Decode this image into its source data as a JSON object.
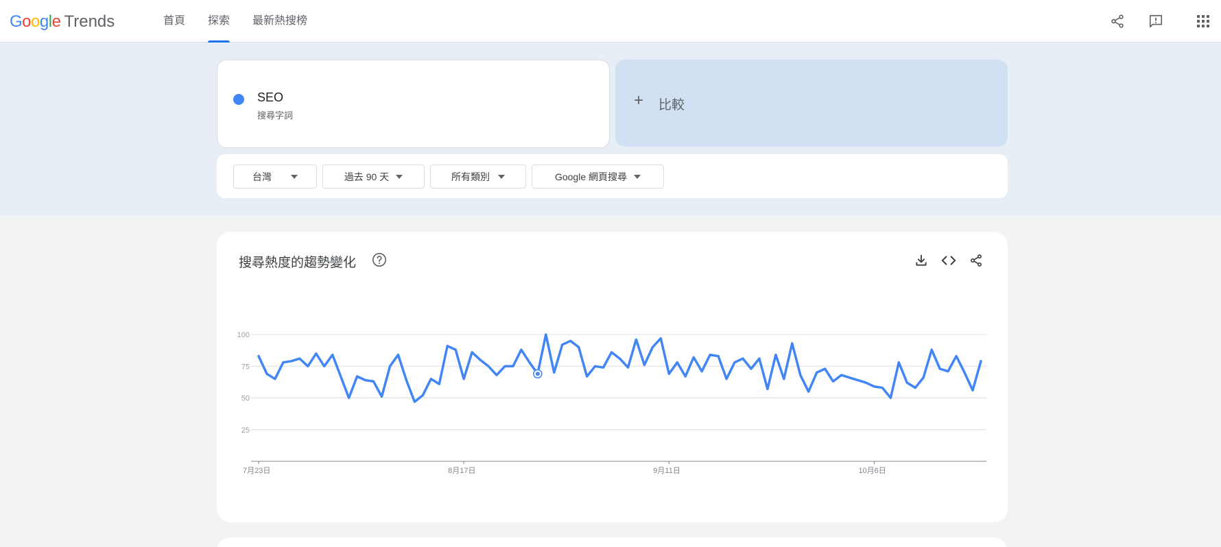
{
  "header": {
    "logo_google": [
      "G",
      "o",
      "o",
      "g",
      "l",
      "e"
    ],
    "logo_colors": [
      "#4285f4",
      "#ea4335",
      "#fbbc05",
      "#4285f4",
      "#34a853",
      "#ea4335"
    ],
    "logo_trends": "Trends",
    "tabs": [
      {
        "label": "首頁",
        "active": false
      },
      {
        "label": "探索",
        "active": true
      },
      {
        "label": "最新熱搜榜",
        "active": false
      }
    ],
    "icons": [
      "share-icon",
      "feedback-icon",
      "apps-grid-icon"
    ]
  },
  "search_term": {
    "name": "SEO",
    "type": "搜尋字詞",
    "color": "#4285f4"
  },
  "compare": {
    "plus": "+",
    "label": "比較"
  },
  "filters": [
    {
      "label": "台灣"
    },
    {
      "label": "過去 90 天"
    },
    {
      "label": "所有類別"
    },
    {
      "label": "Google 網頁搜尋"
    }
  ],
  "chart_card": {
    "title": "搜尋熱度的趨勢變化",
    "icons": [
      "help-icon",
      "download-icon",
      "embed-code-icon",
      "share-icon"
    ]
  },
  "chart_data": {
    "type": "line",
    "x_tick_labels": [
      "7月23日",
      "8月17日",
      "9月11日",
      "10月6日"
    ],
    "x_tick_index": [
      0,
      25,
      50,
      75
    ],
    "y_ticks": [
      25,
      50,
      75,
      100
    ],
    "ylim": [
      0,
      100
    ],
    "grid": true,
    "series": [
      {
        "name": "SEO",
        "color": "#4285f4",
        "values": [
          83,
          69,
          65,
          78,
          79,
          81,
          75,
          85,
          75,
          84,
          67,
          50,
          67,
          64,
          63,
          51,
          75,
          84,
          64,
          47,
          52,
          65,
          61,
          91,
          88,
          65,
          86,
          80,
          75,
          68,
          75,
          75,
          88,
          78,
          69,
          100,
          70,
          92,
          95,
          90,
          67,
          75,
          74,
          86,
          81,
          74,
          96,
          76,
          90,
          97,
          69,
          78,
          67,
          82,
          71,
          84,
          83,
          65,
          78,
          81,
          73,
          81,
          57,
          84,
          65,
          93,
          68,
          55,
          70,
          73,
          63,
          68,
          66,
          64,
          62,
          59,
          58,
          50,
          78,
          62,
          58,
          66,
          88,
          73,
          71,
          83,
          70,
          56,
          79
        ],
        "highlight_index": 34
      }
    ]
  }
}
